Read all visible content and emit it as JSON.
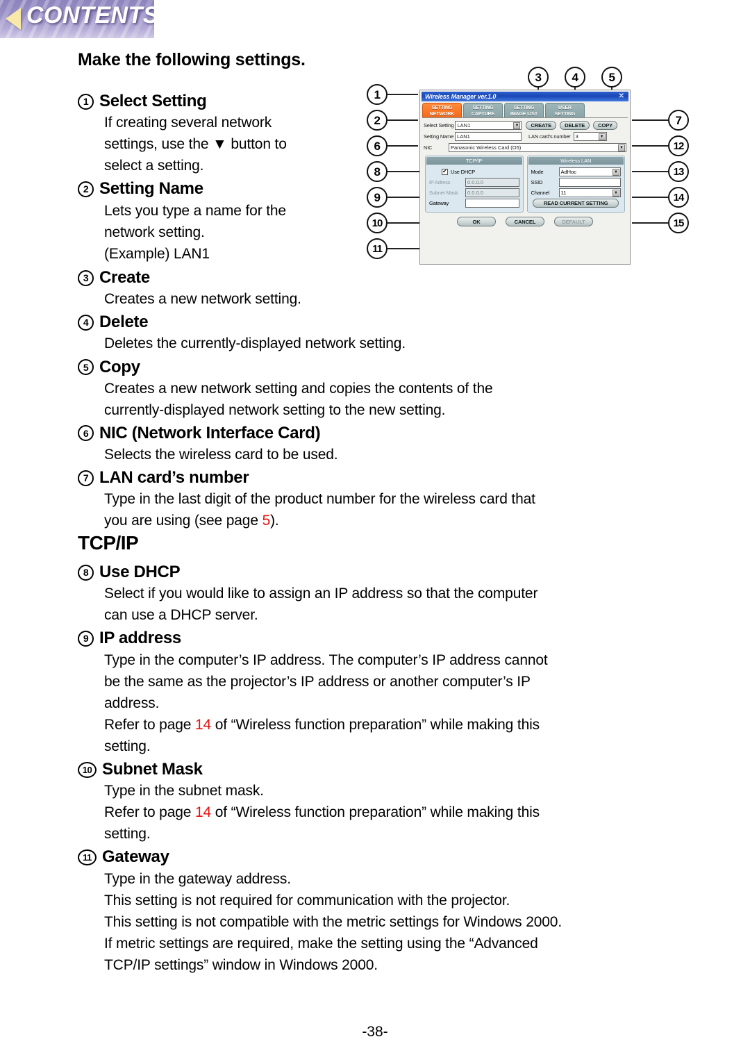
{
  "banner": {
    "label": "CONTENTS",
    "arrow_icon": "left-triangle-icon",
    "accent": "#8d84bd"
  },
  "page_title": "Make the following settings.",
  "section_heading": "TCP/IP",
  "page_number": "-38-",
  "link_color": "#e8110f",
  "entries": [
    {
      "num": "1",
      "title": "Select Setting",
      "lines": [
        "If creating several network",
        "settings, use the ▼ button to",
        "select a setting."
      ]
    },
    {
      "num": "2",
      "title": "Setting Name",
      "lines": [
        "Lets you type a name for the",
        "network setting.",
        "(Example) LAN1"
      ]
    },
    {
      "num": "3",
      "title": "Create",
      "lines": [
        "Creates a new network setting."
      ]
    },
    {
      "num": "4",
      "title": "Delete",
      "lines": [
        "Deletes the currently-displayed network setting."
      ]
    },
    {
      "num": "5",
      "title": "Copy",
      "lines": [
        "Creates a new network setting and copies the contents of the",
        "currently-displayed network setting to the new setting."
      ]
    },
    {
      "num": "6",
      "title": "NIC (Network Interface Card)",
      "lines": [
        "Selects the wireless card to be used."
      ]
    },
    {
      "num": "7",
      "title": "LAN card’s number",
      "line1_pre": "Type in the last digit of the product number for the wireless card that",
      "line2_pre": "you are using (see page ",
      "line2_link": "5",
      "line2_post": ")."
    },
    {
      "num": "8",
      "title": "Use DHCP",
      "lines": [
        "Select if you would like to assign an IP address so that the computer",
        "can use a DHCP server."
      ]
    },
    {
      "num": "9",
      "title": "IP address",
      "lines": [
        "Type in the computer’s IP address. The computer’s IP address cannot",
        "be the same as the projector’s IP address or another computer’s IP",
        "address."
      ],
      "ref_pre": "Refer to page ",
      "ref_link": "14",
      "ref_post": " of “Wireless function preparation” while making this",
      "ref_tail": "setting."
    },
    {
      "num": "10",
      "title": "Subnet Mask",
      "lines": [
        "Type in the subnet mask."
      ],
      "ref_pre": "Refer to page ",
      "ref_link": "14",
      "ref_post": " of “Wireless function preparation” while making this",
      "ref_tail": "setting."
    },
    {
      "num": "11",
      "title": "Gateway",
      "lines": [
        "Type in the gateway address.",
        "This setting is not required for communication with the projector.",
        "This setting is not compatible with the metric settings for Windows 2000.",
        "If metric settings are required, make the setting using the “Advanced",
        "TCP/IP settings” window in Windows 2000."
      ]
    }
  ],
  "figure": {
    "callouts_top": [
      "3",
      "4",
      "5"
    ],
    "callouts_left": [
      "1",
      "2",
      "6",
      "8",
      "9",
      "10",
      "11"
    ],
    "callouts_right": [
      "7",
      "12",
      "13",
      "14",
      "15"
    ],
    "window": {
      "title": "Wireless Manager ver.1.0",
      "close_icon": "close-icon",
      "tabs": [
        {
          "line1": "SETTING",
          "line2": "NETWORK",
          "active": true
        },
        {
          "line1": "SETTING",
          "line2": "CAPTURE",
          "active": false
        },
        {
          "line1": "SETTING",
          "line2": "IMAGE LIST",
          "active": false
        },
        {
          "line1": "USER",
          "line2": "SETTING",
          "active": false
        }
      ],
      "fields": {
        "select_setting_label": "Select Setting",
        "select_setting_value": "LAN1",
        "setting_name_label": "Setting Name",
        "setting_name_value": "LAN1",
        "nic_label": "NIC",
        "nic_value": "Panasonic Wireless Card (O5)",
        "lan_card_number_label": "LAN card's number",
        "lan_card_number_value": "3"
      },
      "action_buttons": [
        "CREATE",
        "DELETE",
        "COPY"
      ],
      "tcpip_group": {
        "title": "TCP/IP",
        "use_dhcp_label": "Use DHCP",
        "use_dhcp_checked": "✔",
        "ip_label": "IP Adress",
        "ip_value": "0.0.0.0",
        "subnet_label": "Subnet Mask",
        "subnet_value": "0.0.0.0",
        "gateway_label": "Gateway",
        "gateway_value": ""
      },
      "wireless_group": {
        "title": "Wireless LAN",
        "mode_label": "Mode",
        "mode_value": "AdHoc",
        "ssid_label": "SSID",
        "ssid_value": "",
        "channel_label": "Channel",
        "channel_value": "11",
        "read_button": "READ CURRENT SETTING"
      },
      "footer_buttons": [
        {
          "label": "OK",
          "dim": false
        },
        {
          "label": "CANCEL",
          "dim": false
        },
        {
          "label": "DEFAULT",
          "dim": true
        }
      ]
    }
  }
}
